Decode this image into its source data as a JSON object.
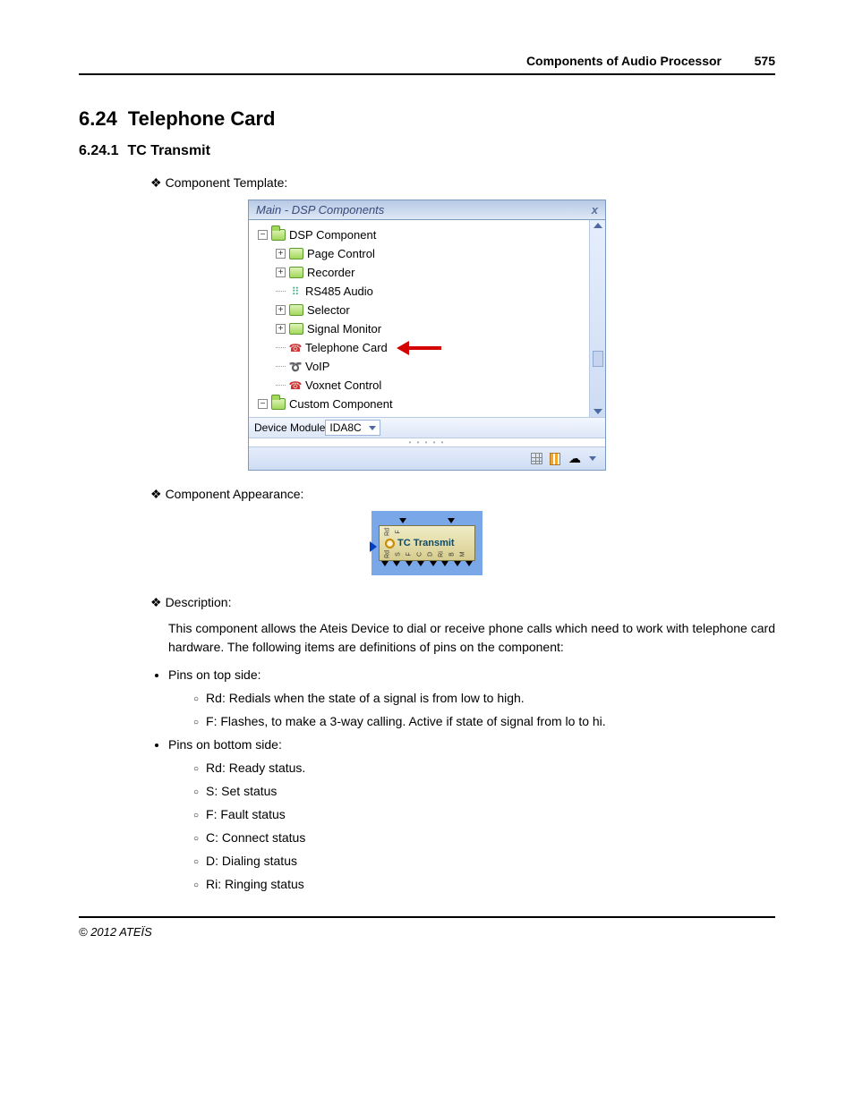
{
  "header": {
    "title": "Components of Audio Processor",
    "page": "575"
  },
  "section": {
    "number": "6.24",
    "title": "Telephone Card"
  },
  "subsection": {
    "number": "6.24.1",
    "title": "TC Transmit"
  },
  "labels": {
    "component_template": "Component Template:",
    "component_appearance": "Component Appearance:",
    "description": "Description:"
  },
  "tree": {
    "title": "Main - DSP Components",
    "close_glyph": "x",
    "items": [
      {
        "label": "DSP Component",
        "level": 0,
        "pm": "−",
        "icon": "folder-open"
      },
      {
        "label": "Page Control",
        "level": 1,
        "pm": "+",
        "icon": "folder"
      },
      {
        "label": "Recorder",
        "level": 1,
        "pm": "+",
        "icon": "folder"
      },
      {
        "label": "RS485 Audio",
        "level": 1,
        "pm": "",
        "icon": "dots"
      },
      {
        "label": "Selector",
        "level": 1,
        "pm": "+",
        "icon": "folder"
      },
      {
        "label": "Signal Monitor",
        "level": 1,
        "pm": "+",
        "icon": "folder"
      },
      {
        "label": "Telephone Card",
        "level": 1,
        "pm": "",
        "icon": "phone",
        "arrow": true
      },
      {
        "label": "VoIP",
        "level": 1,
        "pm": "",
        "icon": "voip"
      },
      {
        "label": "Voxnet Control",
        "level": 1,
        "pm": "",
        "icon": "phone"
      },
      {
        "label": "Custom Component",
        "level": 0,
        "pm": "−",
        "icon": "folder-open"
      }
    ],
    "footer": {
      "label": "Device Module",
      "value": "IDA8C"
    }
  },
  "appearance": {
    "label": "TC Transmit",
    "pins_top": [
      "Rd",
      "F"
    ],
    "pins_bottom": [
      "Rd",
      "S",
      "F",
      "C",
      "D",
      "Ri",
      "B",
      "M"
    ]
  },
  "description_text": "This component allows the Ateis Device to dial or receive phone calls which need to work with telephone card hardware. The following items are definitions of pins on the component:",
  "pins_top_title": "Pins on top side:",
  "pins_top": [
    "Rd: Redials when the state of a signal is from low to high.",
    "F: Flashes, to make a 3-way calling. Active if state of signal from lo to hi."
  ],
  "pins_bottom_title": "Pins on bottom side:",
  "pins_bottom": [
    "Rd: Ready status.",
    "S: Set status",
    "F: Fault status",
    "C: Connect status",
    "D: Dialing status",
    "Ri: Ringing status"
  ],
  "footer": "© 2012 ATEÏS"
}
